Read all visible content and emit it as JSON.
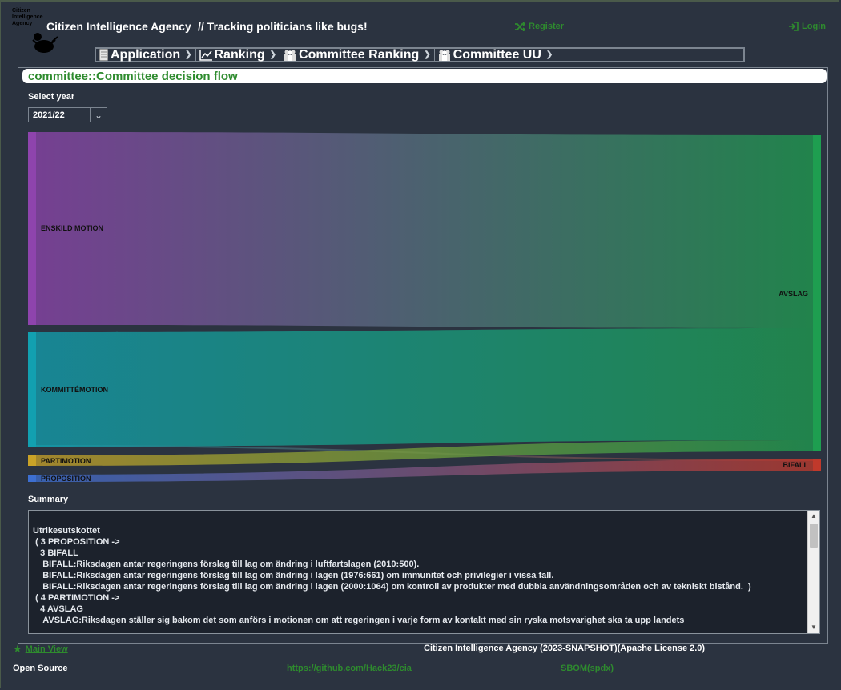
{
  "header": {
    "logo_text": [
      "Citizen",
      "Intelligence",
      "Agency"
    ],
    "title": "Citizen Intelligence Agency",
    "slogan": "// Tracking politicians like bugs!",
    "register": "Register",
    "login": "Login"
  },
  "menu": [
    {
      "label": "Application",
      "icon": "document-icon"
    },
    {
      "label": "Ranking",
      "icon": "chart-line-icon"
    },
    {
      "label": "Committee Ranking",
      "icon": "group-icon"
    },
    {
      "label": "Committee UU",
      "icon": "group-icon"
    }
  ],
  "panel": {
    "title": "committee::Committee decision flow",
    "select_label": "Select year",
    "select_value": "2021/22"
  },
  "sankey": {
    "nodes": [
      {
        "name": "ENSKILD MOTION",
        "color": "#8e44ad"
      },
      {
        "name": "KOMMITTÉMOTION",
        "color": "#12a0b0"
      },
      {
        "name": "PARTIMOTION",
        "color": "#c9a227"
      },
      {
        "name": "PROPOSITION",
        "color": "#3d6fd1"
      },
      {
        "name": "AVSLAG",
        "color": "#1e9e50"
      },
      {
        "name": "BIFALL",
        "color": "#c0392b"
      }
    ]
  },
  "summary": {
    "label": "Summary",
    "text": "Utrikesutskottet\n ( 3 PROPOSITION ->\n   3 BIFALL\n    BIFALL:Riksdagen antar regeringens förslag till lag om ändring i luftfartslagen (2010:500).\n    BIFALL:Riksdagen antar regeringens förslag till lag om ändring i lagen (1976:661) om immunitet och privilegier i vissa fall.\n    BIFALL:Riksdagen antar regeringens förslag till lag om ändring i lagen (2000:1064) om kontroll av produkter med dubbla användningsområden och av tekniskt bistånd.  )\n ( 4 PARTIMOTION ->\n   4 AVSLAG\n    AVSLAG:Riksdagen ställer sig bakom det som anförs i motionen om att regeringen i varje form av kontakt med sin ryska motsvarighet ska ta upp landets"
  },
  "footer": {
    "main_view": "Main View",
    "center": "Citizen Intelligence Agency (2023-SNAPSHOT)(Apache License 2.0)",
    "open_source": "Open Source",
    "github": "https://github.com/Hack23/cia",
    "sbom": "SBOM(spdx)"
  },
  "colors": {
    "accent_green": "#2e8b2e",
    "background": "#2b3340"
  }
}
